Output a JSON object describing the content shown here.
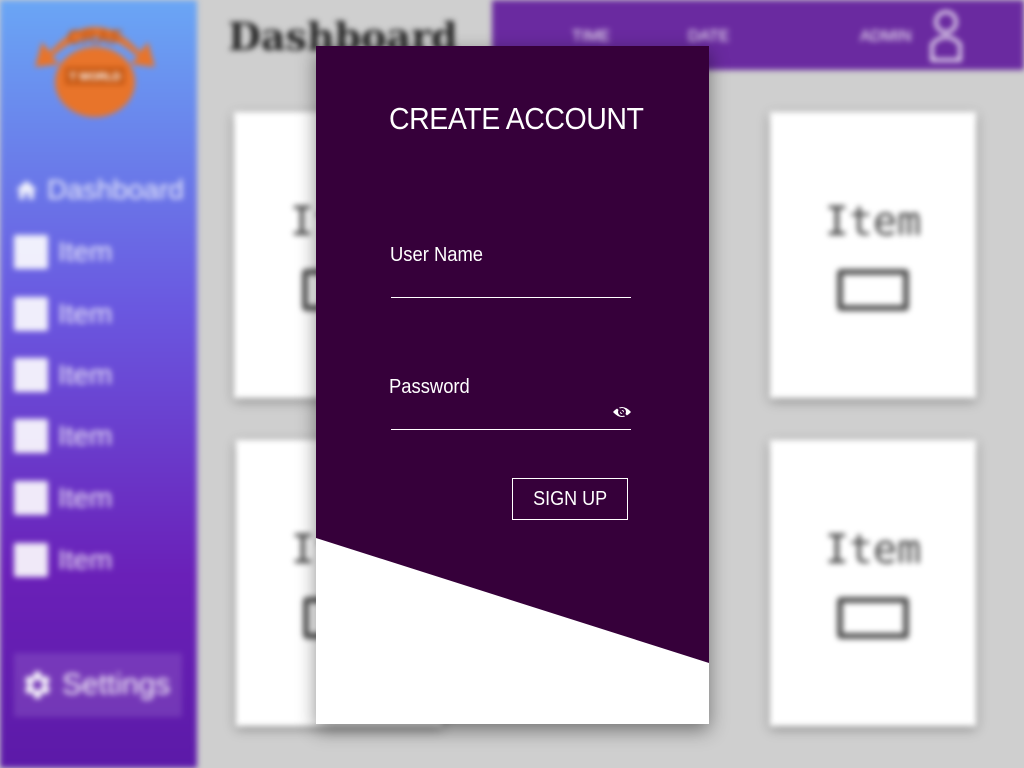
{
  "sidebar": {
    "logo_text_top": "CRAF",
    "logo_text_bottom": "T WORLD",
    "items": [
      {
        "label": "Dashboard",
        "icon": "home-icon"
      },
      {
        "label": "Item",
        "icon": "square-icon"
      },
      {
        "label": "Item",
        "icon": "square-icon"
      },
      {
        "label": "Item",
        "icon": "square-icon"
      },
      {
        "label": "Item",
        "icon": "square-icon"
      },
      {
        "label": "Item",
        "icon": "square-icon"
      },
      {
        "label": "Item",
        "icon": "square-icon"
      }
    ],
    "settings_label": "Settings"
  },
  "header": {
    "title": "Dashboard",
    "topbar": {
      "link1": "TIME",
      "link2": "DATE",
      "user": "ADMIN"
    }
  },
  "cards": [
    {
      "label": "Item"
    },
    {
      "label": "Item"
    },
    {
      "label": "Item"
    },
    {
      "label": "Item"
    }
  ],
  "modal": {
    "title": "CREATE ACCOUNT",
    "username_label": "User Name",
    "username_value": "",
    "password_label": "Password",
    "password_value": "",
    "signup_label": "SIGN UP"
  },
  "colors": {
    "modal_bg": "#36003a",
    "topbar": "#6a2aa0",
    "sidebar_top": "#6aa6f5",
    "sidebar_bottom": "#5c1aa8",
    "logo": "#e8742a"
  }
}
